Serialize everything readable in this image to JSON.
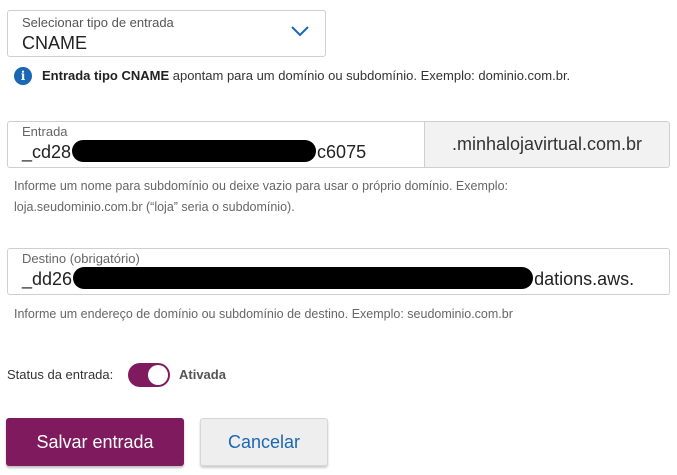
{
  "entry_type": {
    "label": "Selecionar tipo de entrada",
    "value": "CNAME",
    "icon": "chevron-down-icon"
  },
  "info": {
    "icon": "info-icon",
    "bold": "Entrada tipo CNAME",
    "text": " apontam para um domínio ou subdomínio. Exemplo: dominio.com.br."
  },
  "entry": {
    "label": "Entrada",
    "value_prefix": "_cd28",
    "value_suffix": "c6075",
    "addon": ".minhalojavirtual.com.br",
    "help_line1": "Informe um nome para subdomínio ou deixe vazio para usar o próprio domínio. Exemplo:",
    "help_line2": "loja.seudominio.com.br (“loja” seria o subdomínio)."
  },
  "destination": {
    "label": "Destino (obrigatório)",
    "value_prefix": "_dd26",
    "value_suffix": "dations.aws.",
    "help": "Informe um endereço de domínio ou subdomínio de destino. Exemplo: seudominio.com.br"
  },
  "status": {
    "label": "Status da entrada:",
    "state": "Ativada",
    "enabled": true
  },
  "actions": {
    "save": "Salvar entrada",
    "cancel": "Cancelar"
  },
  "colors": {
    "primary": "#7f1a5e",
    "link": "#1a67b3"
  }
}
